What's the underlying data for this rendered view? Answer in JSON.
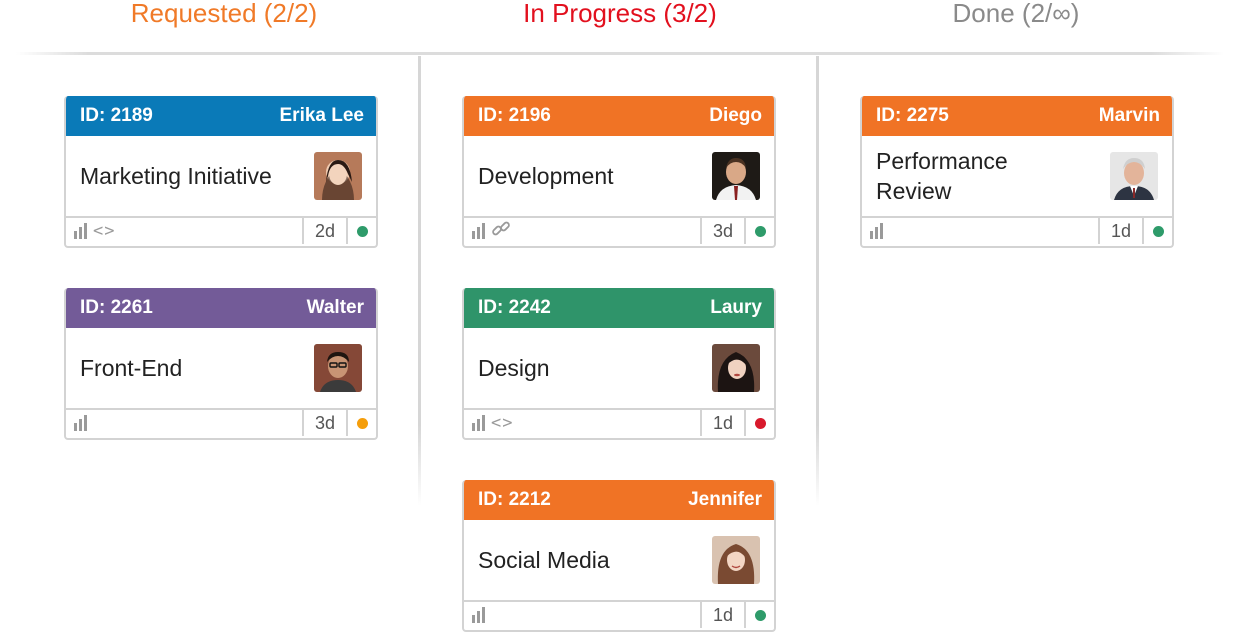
{
  "columns": [
    {
      "title": "Requested (2/2)",
      "color": "#f07a28"
    },
    {
      "title": "In Progress (3/2)",
      "color": "#e2101e"
    },
    {
      "title": "Done (2/∞)",
      "color": "#8a8a8a"
    }
  ],
  "cards": [
    {
      "id": "ID: 2189",
      "assignee": "Erika Lee",
      "title": "Marketing Initiative",
      "duration": "2d",
      "header_color": "#0a7ab8",
      "status_color": "#2e9b6a",
      "icons": [
        "bars-icon",
        "code-icon"
      ]
    },
    {
      "id": "ID: 2261",
      "assignee": "Walter",
      "title": "Front-End",
      "duration": "3d",
      "header_color": "#735b98",
      "status_color": "#f59e0b",
      "icons": [
        "bars-icon"
      ]
    },
    {
      "id": "ID: 2196",
      "assignee": "Diego",
      "title": "Development",
      "duration": "3d",
      "header_color": "#f07325",
      "status_color": "#2e9b6a",
      "icons": [
        "bars-icon",
        "link-icon"
      ]
    },
    {
      "id": "ID: 2242",
      "assignee": "Laury",
      "title": "Design",
      "duration": "1d",
      "header_color": "#2f946a",
      "status_color": "#d8192c",
      "icons": [
        "bars-icon",
        "code-icon"
      ]
    },
    {
      "id": "ID: 2212",
      "assignee": "Jennifer",
      "title": "Social Media",
      "duration": "1d",
      "header_color": "#f07325",
      "status_color": "#2e9b6a",
      "icons": [
        "bars-icon"
      ]
    },
    {
      "id": "ID: 2275",
      "assignee": "Marvin",
      "title": "Performance Review",
      "duration": "1d",
      "header_color": "#f07325",
      "status_color": "#2e9b6a",
      "icons": [
        "bars-icon"
      ]
    }
  ]
}
